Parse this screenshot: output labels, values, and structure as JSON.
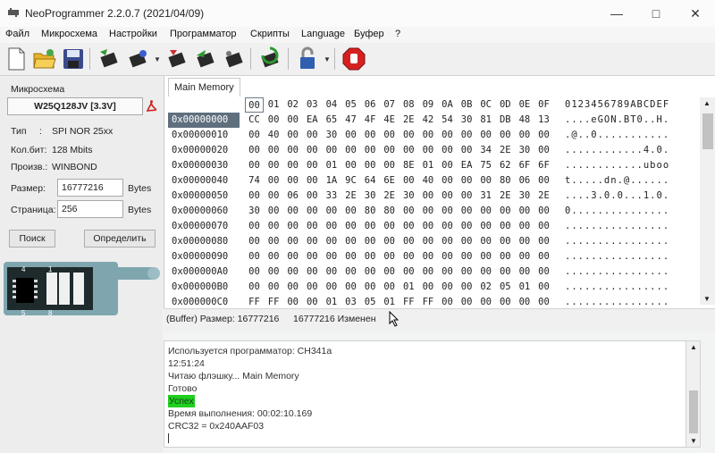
{
  "window": {
    "title": "NeoProgrammer 2.2.0.7 (2021/04/09)"
  },
  "menu": [
    "Файл",
    "Микросхема",
    "Настройки",
    "Программатор",
    "Скрипты",
    "Language",
    "Буфер",
    "?"
  ],
  "toolbar": {
    "icons": [
      "new-file-icon",
      "open-folder-icon",
      "save-icon",
      "read-chip-icon",
      "verify-chip-icon",
      "erase-chip-icon",
      "write-chip-icon",
      "blank-check-icon",
      "auto-chip-icon",
      "lock-icon",
      "stop-icon"
    ]
  },
  "chip": {
    "section_label": "Микросхема",
    "name": "W25Q128JV [3.3V]",
    "type_label": "Тип",
    "type_value": "SPI NOR 25xx",
    "bits_label": "Кол.бит:",
    "bits_value": "128 Mbits",
    "vendor_label": "Произв.:",
    "vendor_value": "WINBOND",
    "size_label": "Размер:",
    "size_value": "16777216",
    "size_unit": "Bytes",
    "page_label": "Страница:",
    "page_value": "256",
    "page_unit": "Bytes",
    "search_button": "Поиск",
    "detect_button": "Определить",
    "pinout": {
      "pin1": "1",
      "pin4": "4",
      "pin5": "5",
      "pin8": "8"
    }
  },
  "hex": {
    "tab_label": "Main Memory",
    "header_cols": [
      "00",
      "01",
      "02",
      "03",
      "04",
      "05",
      "06",
      "07",
      "08",
      "09",
      "0A",
      "0B",
      "0C",
      "0D",
      "0E",
      "0F"
    ],
    "header_ascii": "0123456789ABCDEF",
    "rows": [
      {
        "addr": "0x00000000",
        "bytes": [
          "CC",
          "00",
          "00",
          "EA",
          "65",
          "47",
          "4F",
          "4E",
          "2E",
          "42",
          "54",
          "30",
          "81",
          "DB",
          "48",
          "13"
        ],
        "ascii": "....eGON.BT0..H."
      },
      {
        "addr": "0x00000010",
        "bytes": [
          "00",
          "40",
          "00",
          "00",
          "30",
          "00",
          "00",
          "00",
          "00",
          "00",
          "00",
          "00",
          "00",
          "00",
          "00",
          "00"
        ],
        "ascii": ".@..0..........."
      },
      {
        "addr": "0x00000020",
        "bytes": [
          "00",
          "00",
          "00",
          "00",
          "00",
          "00",
          "00",
          "00",
          "00",
          "00",
          "00",
          "00",
          "34",
          "2E",
          "30",
          "00"
        ],
        "ascii": "............4.0."
      },
      {
        "addr": "0x00000030",
        "bytes": [
          "00",
          "00",
          "00",
          "00",
          "01",
          "00",
          "00",
          "00",
          "8E",
          "01",
          "00",
          "EA",
          "75",
          "62",
          "6F",
          "6F"
        ],
        "ascii": "............uboo"
      },
      {
        "addr": "0x00000040",
        "bytes": [
          "74",
          "00",
          "00",
          "00",
          "1A",
          "9C",
          "64",
          "6E",
          "00",
          "40",
          "00",
          "00",
          "00",
          "80",
          "06",
          "00"
        ],
        "ascii": "t.....dn.@......"
      },
      {
        "addr": "0x00000050",
        "bytes": [
          "00",
          "00",
          "06",
          "00",
          "33",
          "2E",
          "30",
          "2E",
          "30",
          "00",
          "00",
          "00",
          "31",
          "2E",
          "30",
          "2E"
        ],
        "ascii": "....3.0.0...1.0."
      },
      {
        "addr": "0x00000060",
        "bytes": [
          "30",
          "00",
          "00",
          "00",
          "00",
          "00",
          "80",
          "80",
          "00",
          "00",
          "00",
          "00",
          "00",
          "00",
          "00",
          "00"
        ],
        "ascii": "0..............."
      },
      {
        "addr": "0x00000070",
        "bytes": [
          "00",
          "00",
          "00",
          "00",
          "00",
          "00",
          "00",
          "00",
          "00",
          "00",
          "00",
          "00",
          "00",
          "00",
          "00",
          "00"
        ],
        "ascii": "................"
      },
      {
        "addr": "0x00000080",
        "bytes": [
          "00",
          "00",
          "00",
          "00",
          "00",
          "00",
          "00",
          "00",
          "00",
          "00",
          "00",
          "00",
          "00",
          "00",
          "00",
          "00"
        ],
        "ascii": "................"
      },
      {
        "addr": "0x00000090",
        "bytes": [
          "00",
          "00",
          "00",
          "00",
          "00",
          "00",
          "00",
          "00",
          "00",
          "00",
          "00",
          "00",
          "00",
          "00",
          "00",
          "00"
        ],
        "ascii": "................"
      },
      {
        "addr": "0x000000A0",
        "bytes": [
          "00",
          "00",
          "00",
          "00",
          "00",
          "00",
          "00",
          "00",
          "00",
          "00",
          "00",
          "00",
          "00",
          "00",
          "00",
          "00"
        ],
        "ascii": "................"
      },
      {
        "addr": "0x000000B0",
        "bytes": [
          "00",
          "00",
          "00",
          "00",
          "00",
          "00",
          "00",
          "00",
          "01",
          "00",
          "00",
          "00",
          "02",
          "05",
          "01",
          "00"
        ],
        "ascii": "................"
      },
      {
        "addr": "0x000000C0",
        "bytes": [
          "FF",
          "FF",
          "00",
          "00",
          "01",
          "03",
          "05",
          "01",
          "FF",
          "FF",
          "00",
          "00",
          "00",
          "00",
          "00",
          "00"
        ],
        "ascii": "................"
      }
    ]
  },
  "status": {
    "buffer_size_label": "(Buffer) Размер: 16777216",
    "changed_label": "16777216 Изменен"
  },
  "log": {
    "lines": [
      "Используется программатор: CH341a",
      "12:51:24",
      "Читаю флэшку... Main Memory",
      "Готово",
      "Успех",
      "Время выполнения: 00:02:10.169",
      "CRC32 = 0x240AAF03"
    ]
  },
  "colors": {
    "selected_addr_bg": "#5f6f7e",
    "success_bg": "#1fd01f",
    "pdf_red": "#cc2222"
  }
}
